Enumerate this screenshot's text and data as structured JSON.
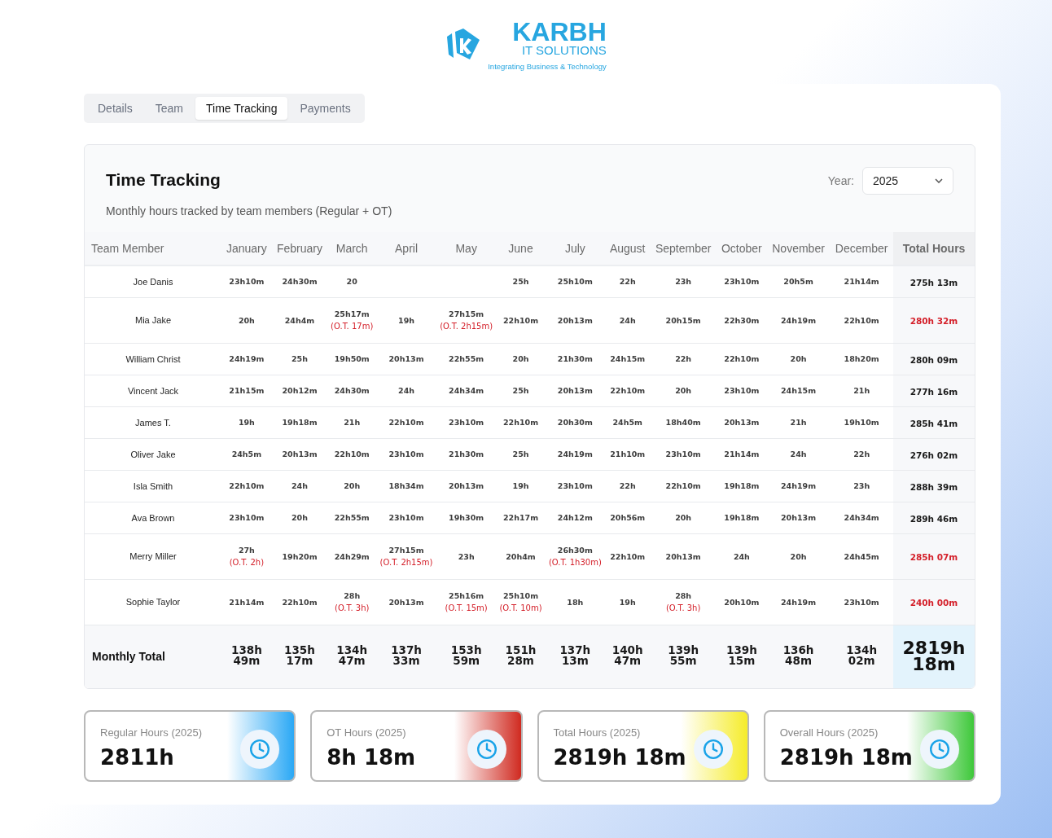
{
  "logo": {
    "name": "KARBH",
    "subtitle": "IT SOLUTIONS",
    "tagline": "Integrating Business & Technology"
  },
  "tabs": [
    {
      "label": "Details",
      "selected": false
    },
    {
      "label": "Team",
      "selected": false
    },
    {
      "label": "Time Tracking",
      "selected": true
    },
    {
      "label": "Payments",
      "selected": false
    }
  ],
  "card": {
    "title": "Time Tracking",
    "subtitle": "Monthly hours tracked by team members (Regular + OT)",
    "year_label": "Year:",
    "year_value": "2025"
  },
  "table": {
    "columns": [
      "Team Member",
      "January",
      "February",
      "March",
      "April",
      "May",
      "June",
      "July",
      "August",
      "September",
      "October",
      "November",
      "December",
      "Total Hours"
    ],
    "rows": [
      {
        "overtime": false,
        "cells": [
          {
            "value": "Joe Danis"
          },
          {
            "value": "23h10m"
          },
          {
            "value": "24h30m"
          },
          {
            "value": "20"
          },
          {},
          {},
          {
            "value": "25h"
          },
          {
            "value": "25h10m"
          },
          {
            "value": "22h"
          },
          {
            "value": "23h"
          },
          {
            "value": "23h10m"
          },
          {
            "value": "20h5m"
          },
          {
            "value": "21h14m"
          },
          {
            "value": "275h 13m"
          }
        ]
      },
      {
        "overtime": true,
        "cells": [
          {
            "value": "Mia Jake"
          },
          {
            "value": "20h"
          },
          {
            "value": "24h4m"
          },
          {
            "value": "25h17m",
            "ot": "(O.T. 17m)"
          },
          {
            "value": "19h"
          },
          {
            "value": "27h15m",
            "ot": "(O.T. 2h15m)"
          },
          {
            "value": "22h10m"
          },
          {
            "value": "20h13m"
          },
          {
            "value": "24h"
          },
          {
            "value": "20h15m"
          },
          {
            "value": "22h30m"
          },
          {
            "value": "24h19m"
          },
          {
            "value": "22h10m"
          },
          {
            "value": "280h 32m"
          }
        ]
      },
      {
        "overtime": false,
        "cells": [
          {
            "value": "William Christ"
          },
          {
            "value": "24h19m"
          },
          {
            "value": "25h"
          },
          {
            "value": "19h50m"
          },
          {
            "value": "20h13m"
          },
          {
            "value": "22h55m"
          },
          {
            "value": "20h"
          },
          {
            "value": "21h30m"
          },
          {
            "value": "24h15m"
          },
          {
            "value": "22h"
          },
          {
            "value": "22h10m"
          },
          {
            "value": "20h"
          },
          {
            "value": "18h20m"
          },
          {
            "value": "280h 09m"
          }
        ]
      },
      {
        "overtime": false,
        "cells": [
          {
            "value": "Vincent Jack"
          },
          {
            "value": "21h15m"
          },
          {
            "value": "20h12m"
          },
          {
            "value": "24h30m"
          },
          {
            "value": "24h"
          },
          {
            "value": "24h34m"
          },
          {
            "value": "25h"
          },
          {
            "value": "20h13m"
          },
          {
            "value": "22h10m"
          },
          {
            "value": "20h"
          },
          {
            "value": "23h10m"
          },
          {
            "value": "24h15m"
          },
          {
            "value": "21h"
          },
          {
            "value": "277h 16m"
          }
        ]
      },
      {
        "overtime": false,
        "cells": [
          {
            "value": "James T."
          },
          {
            "value": "19h"
          },
          {
            "value": "19h18m"
          },
          {
            "value": "21h"
          },
          {
            "value": "22h10m"
          },
          {
            "value": "23h10m"
          },
          {
            "value": "22h10m"
          },
          {
            "value": "20h30m"
          },
          {
            "value": "24h5m"
          },
          {
            "value": "18h40m"
          },
          {
            "value": "20h13m"
          },
          {
            "value": "21h"
          },
          {
            "value": "19h10m"
          },
          {
            "value": "285h 41m"
          }
        ]
      },
      {
        "overtime": false,
        "cells": [
          {
            "value": "Oliver Jake"
          },
          {
            "value": "24h5m"
          },
          {
            "value": "20h13m"
          },
          {
            "value": "22h10m"
          },
          {
            "value": "23h10m"
          },
          {
            "value": "21h30m"
          },
          {
            "value": "25h"
          },
          {
            "value": "24h19m"
          },
          {
            "value": "21h10m"
          },
          {
            "value": "23h10m"
          },
          {
            "value": "21h14m"
          },
          {
            "value": "24h"
          },
          {
            "value": "22h"
          },
          {
            "value": "276h 02m"
          }
        ]
      },
      {
        "overtime": false,
        "cells": [
          {
            "value": "Isla Smith"
          },
          {
            "value": "22h10m"
          },
          {
            "value": "24h"
          },
          {
            "value": "20h"
          },
          {
            "value": "18h34m"
          },
          {
            "value": "20h13m"
          },
          {
            "value": "19h"
          },
          {
            "value": "23h10m"
          },
          {
            "value": "22h"
          },
          {
            "value": "22h10m"
          },
          {
            "value": "19h18m"
          },
          {
            "value": "24h19m"
          },
          {
            "value": "23h"
          },
          {
            "value": "288h 39m"
          }
        ]
      },
      {
        "overtime": false,
        "cells": [
          {
            "value": "Ava Brown"
          },
          {
            "value": "23h10m"
          },
          {
            "value": "20h"
          },
          {
            "value": "22h55m"
          },
          {
            "value": "23h10m"
          },
          {
            "value": "19h30m"
          },
          {
            "value": "22h17m"
          },
          {
            "value": "24h12m"
          },
          {
            "value": "20h56m"
          },
          {
            "value": "20h"
          },
          {
            "value": "19h18m"
          },
          {
            "value": "20h13m"
          },
          {
            "value": "24h34m"
          },
          {
            "value": "289h 46m"
          }
        ]
      },
      {
        "overtime": true,
        "cells": [
          {
            "value": "Merry Miller"
          },
          {
            "value": "27h",
            "ot": "(O.T. 2h)"
          },
          {
            "value": "19h20m"
          },
          {
            "value": "24h29m"
          },
          {
            "value": "27h15m",
            "ot": "(O.T. 2h15m)"
          },
          {
            "value": "23h"
          },
          {
            "value": "20h4m"
          },
          {
            "value": "26h30m",
            "ot": "(O.T. 1h30m)"
          },
          {
            "value": "22h10m"
          },
          {
            "value": "20h13m"
          },
          {
            "value": "24h"
          },
          {
            "value": "20h"
          },
          {
            "value": "24h45m"
          },
          {
            "value": "285h 07m"
          }
        ]
      },
      {
        "overtime": true,
        "cells": [
          {
            "value": "Sophie Taylor"
          },
          {
            "value": "21h14m"
          },
          {
            "value": "22h10m"
          },
          {
            "value": "28h",
            "ot": "(O.T. 3h)"
          },
          {
            "value": "20h13m"
          },
          {
            "value": "25h16m",
            "ot": "(O.T. 15m)"
          },
          {
            "value": "25h10m",
            "ot": "(O.T. 10m)"
          },
          {
            "value": "18h"
          },
          {
            "value": "19h"
          },
          {
            "value": "28h",
            "ot": "(O.T. 3h)"
          },
          {
            "value": "20h10m"
          },
          {
            "value": "24h19m"
          },
          {
            "value": "23h10m"
          },
          {
            "value": "240h 00m"
          }
        ]
      }
    ],
    "footer": [
      "Monthly Total",
      "138h 49m",
      "135h 17m",
      "134h 47m",
      "137h 33m",
      "153h 59m",
      "151h 28m",
      "137h 13m",
      "140h 47m",
      "139h 55m",
      "139h 15m",
      "136h 48m",
      "134h 02m",
      "2819h 18m"
    ]
  },
  "stats": [
    {
      "label": "Regular Hours (2025)",
      "value": "2811h",
      "color": "#2aa8f5"
    },
    {
      "label": "OT Hours (2025)",
      "value": "8h 18m",
      "color": "#d02a20"
    },
    {
      "label": "Total Hours (2025)",
      "value": "2819h 18m",
      "color": "#f5ec2a"
    },
    {
      "label": "Overall Hours (2025)",
      "value": "2819h 18m",
      "color": "#3ec83a"
    }
  ]
}
